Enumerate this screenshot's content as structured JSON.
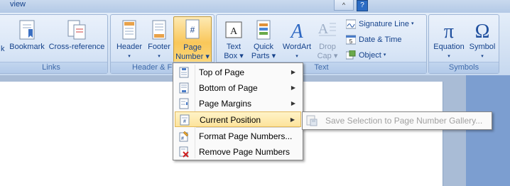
{
  "window": {
    "tab_label": "view",
    "collapse_label": "^",
    "help_label": "?"
  },
  "ribbon": {
    "links": {
      "label": "Links",
      "partial_label": "k",
      "bookmark": "Bookmark",
      "crossref": "Cross-reference"
    },
    "header_footer": {
      "label": "Header & F",
      "header_l1": "Header",
      "header_arrow": "▾",
      "footer_l1": "Footer",
      "footer_arrow": "▾",
      "page_number_l1": "Page",
      "page_number_l2": "Number ▾"
    },
    "text": {
      "label": "Text",
      "textbox_l1": "Text",
      "textbox_l2": "Box ▾",
      "quickparts_l1": "Quick",
      "quickparts_l2": "Parts ▾",
      "wordart_l1": "WordArt",
      "wordart_l2": "▾",
      "dropcap_l1": "Drop",
      "dropcap_l2": "Cap ▾",
      "signature_line": "Signature Line",
      "date_time": "Date & Time",
      "object": "Object"
    },
    "symbols": {
      "label": "Symbols",
      "equation": "Equation",
      "equation_arrow": "▾",
      "symbol": "Symbol",
      "symbol_arrow": "▾"
    }
  },
  "page_number_menu": {
    "items": [
      {
        "label": "Top of Page",
        "submenu": true
      },
      {
        "label": "Bottom of Page",
        "submenu": true
      },
      {
        "label": "Page Margins",
        "submenu": true
      },
      {
        "label": "Current Position",
        "submenu": true,
        "highlighted": true
      },
      {
        "label": "Format Page Numbers...",
        "submenu": false
      },
      {
        "label": "Remove Page Numbers",
        "submenu": false
      }
    ],
    "submenu_arrow": "▶"
  },
  "current_position_submenu": {
    "items": [
      {
        "label": "Save Selection to Page Number Gallery...",
        "disabled": true
      }
    ]
  }
}
